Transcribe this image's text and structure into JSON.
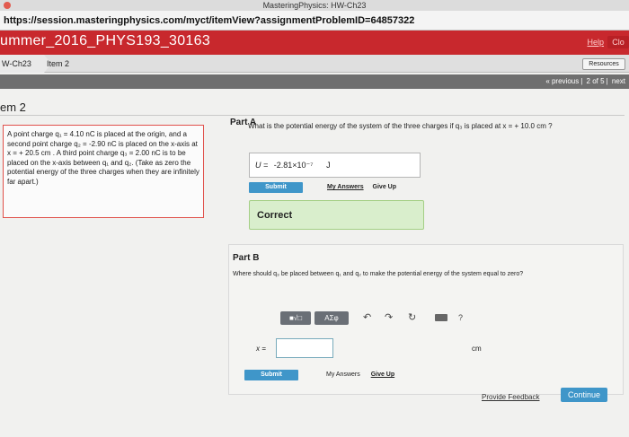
{
  "window": {
    "title": "MasteringPhysics: HW-Ch23",
    "url": "https://session.masteringphysics.com/myct/itemView?assignmentProblemID=64857322"
  },
  "header": {
    "course": "ummer_2016_PHYS193_30163",
    "help": "Help",
    "close": "Clo"
  },
  "breadcrumb": {
    "assignment": "W-Ch23",
    "item": "Item 2",
    "resources": "Resources"
  },
  "pager": {
    "previous": "« previous",
    "position": "2 of 5",
    "next": "next"
  },
  "item_heading": "em 2",
  "problem": {
    "text": "A point charge q₁ = 4.10 nC is placed at the origin, and a second point charge q₂ = -2.90 nC is placed on the x-axis at x = + 20.5 cm . A third point charge q₃ = 2.00 nC is to be placed on the x-axis between q₁ and q₂. (Take as zero the potential energy of the three charges when they are infinitely far apart.)"
  },
  "partA": {
    "title": "Part A",
    "question": "What is the potential energy of the system of the three charges if q₃ is placed at x = + 10.0 cm ?",
    "answer_label": "U =",
    "answer_value": "-2.81×10⁻⁷",
    "answer_unit": "J",
    "submit": "Submit",
    "my_answers": "My Answers",
    "give_up": "Give Up",
    "feedback": "Correct"
  },
  "partB": {
    "title": "Part B",
    "question": "Where should q₃ be placed between q₁ and q₂ to make the potential energy of the system equal to zero?",
    "toolbar_math": "■√□",
    "toolbar_greek": "ΑΣφ",
    "undo_icon": "↶",
    "redo_icon": "↷",
    "reset_icon": "↻",
    "help_icon": "?",
    "input_label": "x =",
    "unit": "cm",
    "submit": "Submit",
    "my_answers": "My Answers",
    "give_up": "Give Up"
  },
  "footer": {
    "provide_feedback": "Provide Feedback",
    "continue": "Continue"
  }
}
